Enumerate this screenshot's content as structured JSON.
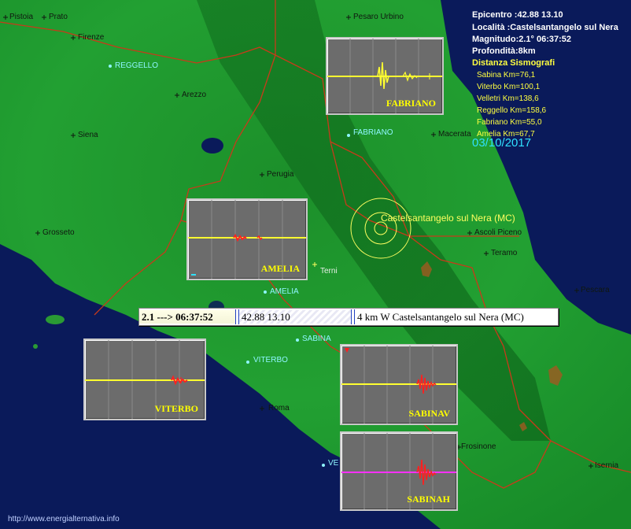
{
  "info": {
    "epicentro": "Epicentro :42.88 13.10",
    "localita": "Località :Castelsantangelo sul Nera",
    "magnitudo": "Magnitudo:2.1°  06:37:52",
    "profondita": "Profondità:8km",
    "distanza_title": "Distanza Sismografi",
    "distances": [
      "Sabina Km=76,1",
      "Viterbo Km=100,1",
      "Velletri Km=138,6",
      "Reggello Km=158,6",
      "Fabriano Km=55,0",
      "Amelia Km=67,7"
    ],
    "date": "03/10/2017"
  },
  "epicenter_label": "Castelsantangelo sul Nera (MC)",
  "cities": [
    {
      "name": "Pistoia",
      "class": ""
    },
    {
      "name": "Prato",
      "class": ""
    },
    {
      "name": "Pesaro Urbino",
      "class": ""
    },
    {
      "name": "Firenze",
      "class": ""
    },
    {
      "name": "REGGELLO",
      "class": "cyan"
    },
    {
      "name": "Arezzo",
      "class": ""
    },
    {
      "name": "Siena",
      "class": ""
    },
    {
      "name": "FABRIANO",
      "class": "cyan"
    },
    {
      "name": "Macerata",
      "class": ""
    },
    {
      "name": "Perugia",
      "class": ""
    },
    {
      "name": "Grosseto",
      "class": ""
    },
    {
      "name": "Ascoli Piceno",
      "class": ""
    },
    {
      "name": "Teramo",
      "class": ""
    },
    {
      "name": "Terni",
      "class": "light"
    },
    {
      "name": "AMELIA",
      "class": "cyan"
    },
    {
      "name": "Pescara",
      "class": ""
    },
    {
      "name": "SABINA",
      "class": "cyan"
    },
    {
      "name": "VITERBO",
      "class": "cyan"
    },
    {
      "name": "Roma",
      "class": ""
    },
    {
      "name": "VE",
      "class": "cyan"
    },
    {
      "name": "Isernia",
      "class": ""
    },
    {
      "name": "Frosinone",
      "class": ""
    }
  ],
  "panels": {
    "fabriano": "FABRIANO",
    "amelia": "AMELIA",
    "viterbo": "VITERBO",
    "sabinav": "SABINAV",
    "sabinah": "SABINAH"
  },
  "status_bar": {
    "magnitude_time": "2.1 ---> 06:37:52",
    "coordinates": "42.88 13.10",
    "location": "4 km W Castelsantangelo sul Nera (MC)"
  },
  "footer": "http://www.energialternativa.info",
  "colors": {
    "sea": "#0a1a5a",
    "land": "#1f8a2a",
    "border": "#c83a1a",
    "trace_yellow": "#ffff30",
    "trace_red": "#ff2020",
    "trace_magenta": "#ff30ff"
  }
}
